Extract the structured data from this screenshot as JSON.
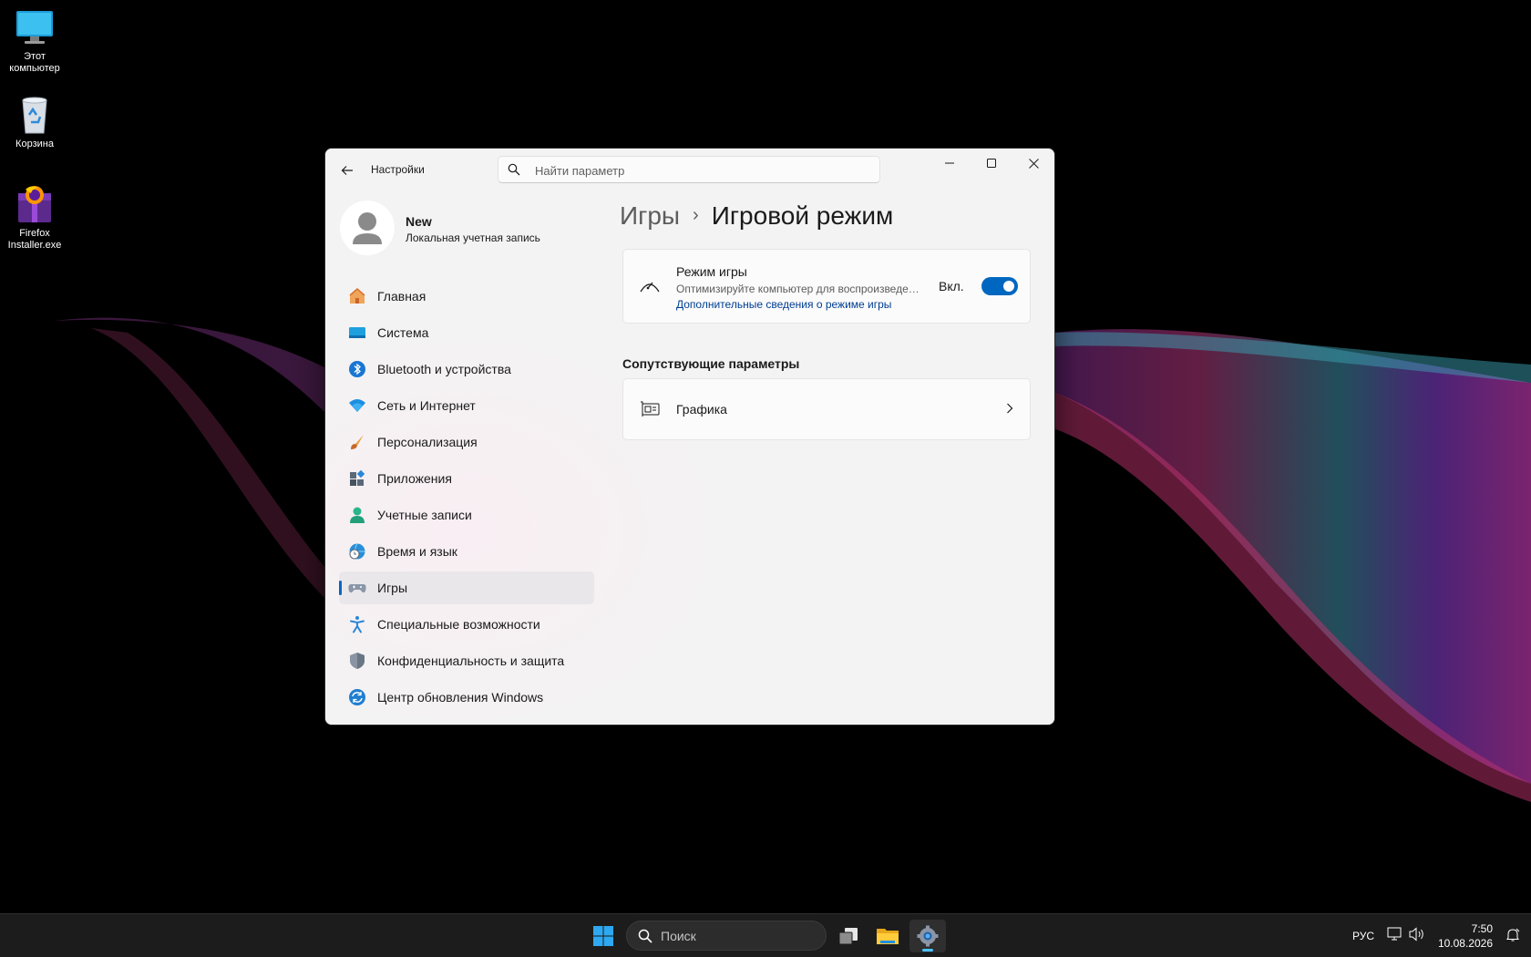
{
  "desktop": {
    "icons": [
      {
        "label": "Этот компьютер",
        "icon": "monitor-icon"
      },
      {
        "label": "Корзина",
        "icon": "recycle-bin-icon"
      },
      {
        "label": "Firefox Installer.exe",
        "icon": "firefox-installer-icon"
      }
    ]
  },
  "window": {
    "title": "Настройки",
    "search_placeholder": "Найти параметр",
    "user": {
      "name": "New",
      "account_type": "Локальная учетная запись"
    },
    "nav": [
      {
        "label": "Главная",
        "icon": "home-icon"
      },
      {
        "label": "Система",
        "icon": "system-icon"
      },
      {
        "label": "Bluetooth и устройства",
        "icon": "bluetooth-icon"
      },
      {
        "label": "Сеть и Интернет",
        "icon": "wifi-icon"
      },
      {
        "label": "Персонализация",
        "icon": "brush-icon"
      },
      {
        "label": "Приложения",
        "icon": "apps-icon"
      },
      {
        "label": "Учетные записи",
        "icon": "accounts-icon"
      },
      {
        "label": "Время и язык",
        "icon": "time-language-icon"
      },
      {
        "label": "Игры",
        "icon": "gaming-icon",
        "active": true
      },
      {
        "label": "Специальные возможности",
        "icon": "accessibility-icon"
      },
      {
        "label": "Конфиденциальность и защита",
        "icon": "shield-icon"
      },
      {
        "label": "Центр обновления Windows",
        "icon": "update-icon"
      }
    ],
    "breadcrumb": {
      "parent": "Игры",
      "separator": "›",
      "current": "Игровой режим"
    },
    "game_mode_card": {
      "title": "Режим игры",
      "description": "Оптимизируйте компьютер для воспроизведения",
      "link": "Дополнительные сведения о режиме игры",
      "toggle_label": "Вкл.",
      "toggle_on": true
    },
    "related_section_title": "Сопутствующие параметры",
    "related": [
      {
        "label": "Графика",
        "icon": "graphics-card-icon"
      }
    ]
  },
  "taskbar": {
    "search_label": "Поиск",
    "language": "РУС",
    "time": "7:50",
    "date": "10.08.2026"
  },
  "colors": {
    "accent": "#0067c0",
    "link": "#003e92",
    "taskbar": "#1c1c1c"
  }
}
